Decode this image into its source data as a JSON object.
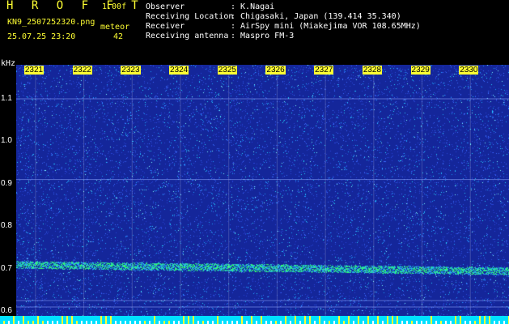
{
  "header": {
    "app_title": "H R O F F T",
    "version": "1.00f",
    "filename": "KN9_2507252320.png",
    "mode": "meteor",
    "datetime": "25.07.25 23:20",
    "count": "42",
    "info": [
      {
        "label": "Observer",
        "value": ": K.Nagai"
      },
      {
        "label": "Receiving Location",
        "value": ": Chigasaki, Japan (139.414 35.340)"
      },
      {
        "label": "Receiver",
        "value": ": AirSpy mini (Miakejima VOR 108.65MHz)"
      },
      {
        "label": "Receiving antenna",
        "value": ": Maspro FM-3"
      }
    ]
  },
  "colors": {
    "background": "#000000",
    "title": "#ffff33",
    "header_label": "#ffffff",
    "header_accent": "#ffff33",
    "plot_background": "#14269a",
    "echo_band": "#33ff66",
    "time_tick_bg": "#ffff33",
    "bottom_bar": "#00e0ff"
  },
  "chart_data": {
    "type": "heatmap",
    "ylabel": "kHz",
    "y_ticks": [
      "1.1",
      "1.0",
      "0.9",
      "0.8",
      "0.7",
      "0.6"
    ],
    "y_tick_values": [
      1.1,
      1.0,
      0.9,
      0.8,
      0.7,
      0.6
    ],
    "ylim": [
      0.57,
      1.18
    ],
    "x_ticks": [
      "2321",
      "2322",
      "2323",
      "2324",
      "2325",
      "2326",
      "2327",
      "2328",
      "2329",
      "2330"
    ],
    "x_tick_values": [
      2321,
      2322,
      2323,
      2324,
      2325,
      2326,
      2327,
      2328,
      2329,
      2330
    ],
    "xlim": [
      2320.6,
      2330.8
    ],
    "carrier_band": {
      "start_khz": 0.71,
      "end_khz": 0.695
    },
    "reference_lines_khz": [
      1.1,
      0.91,
      0.625,
      0.61
    ]
  }
}
